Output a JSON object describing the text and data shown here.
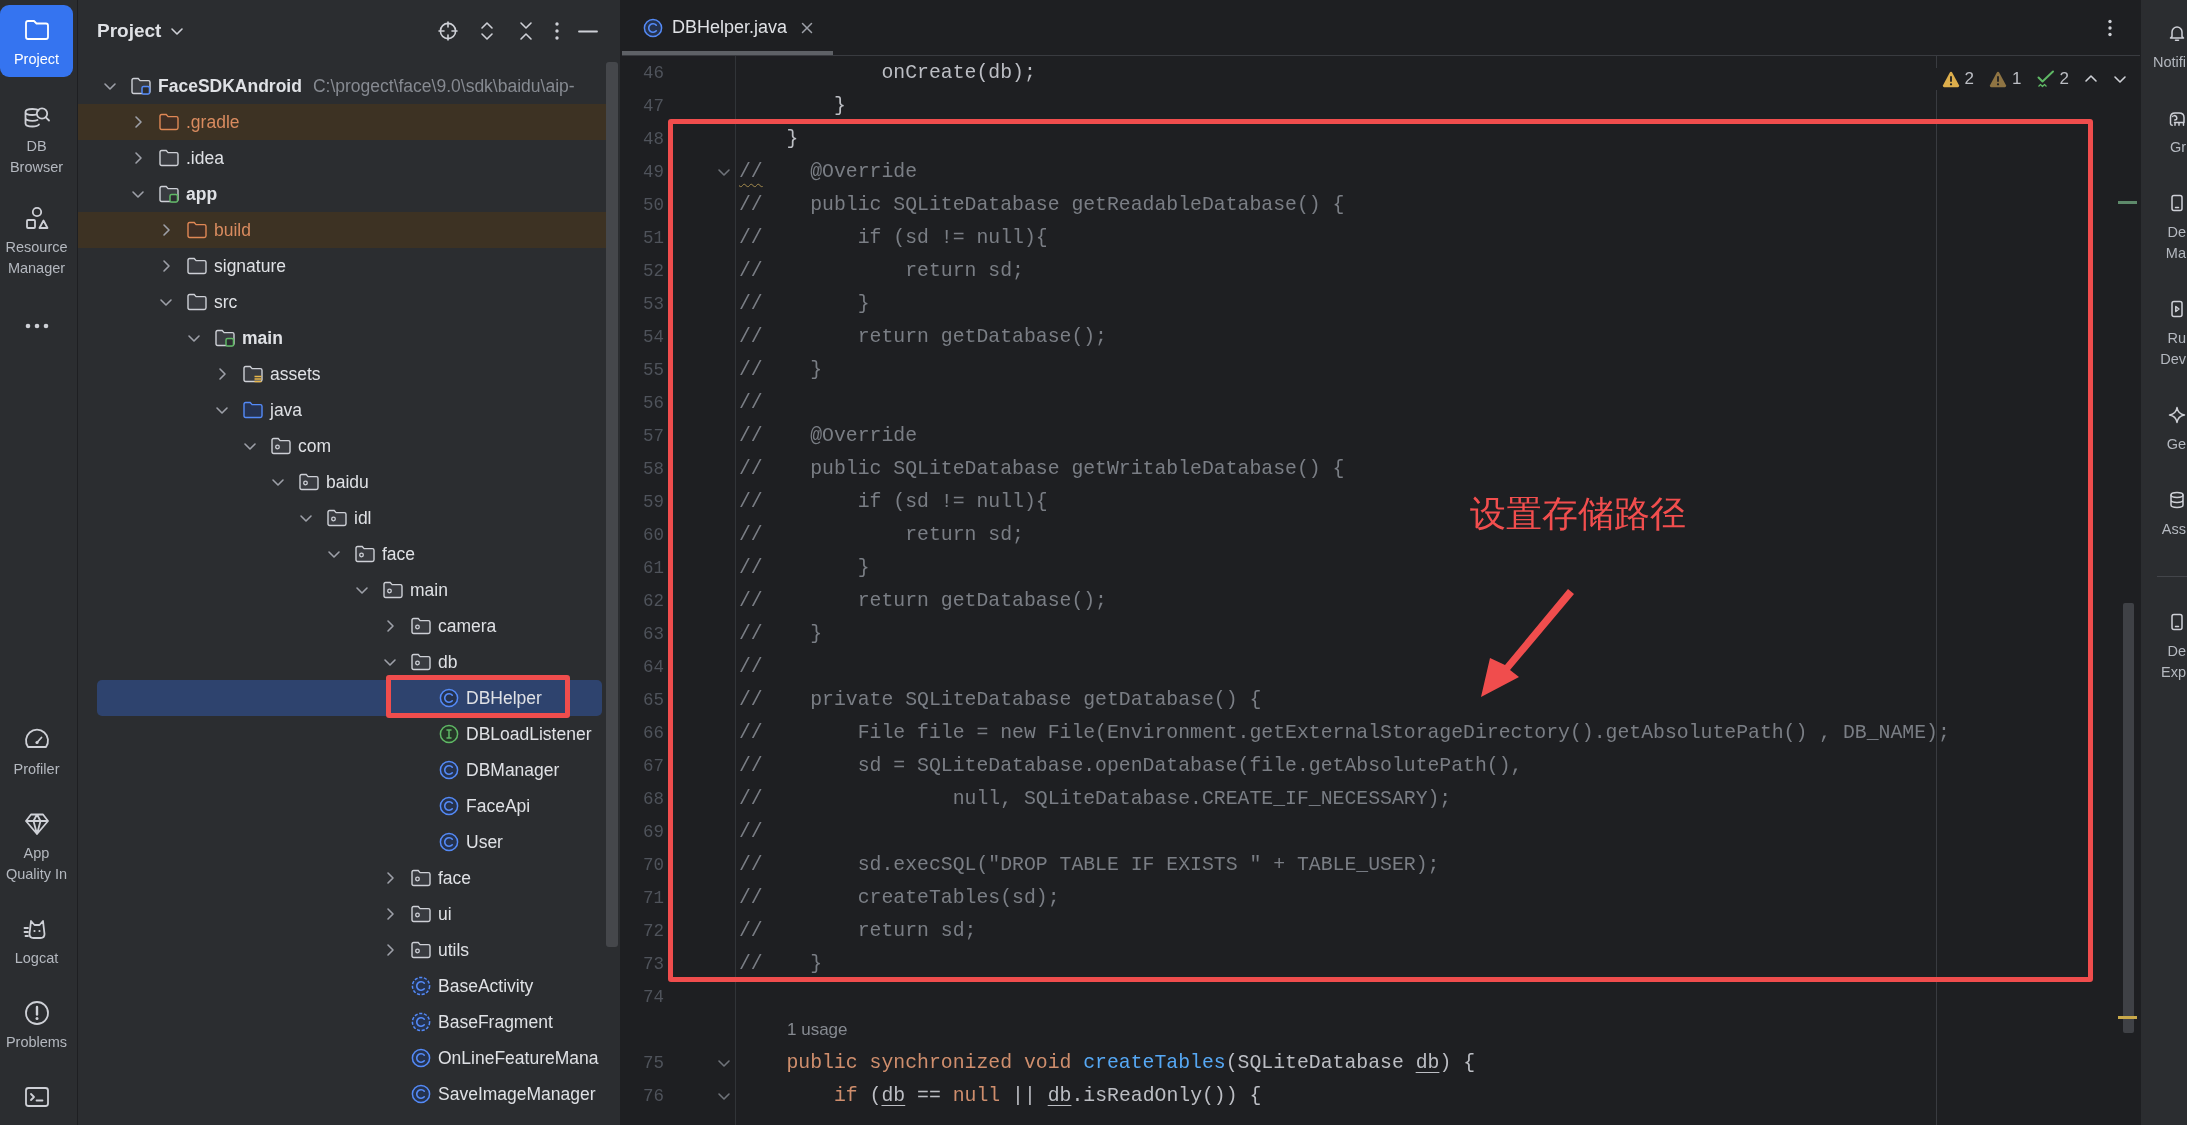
{
  "tool_strip": {
    "top": [
      {
        "kind": "project",
        "label": "Project",
        "selected": true
      },
      {
        "kind": "db_browser",
        "label": "DB Browser",
        "selected": false
      },
      {
        "kind": "resources",
        "label": "Resource Manager",
        "selected": false
      },
      {
        "kind": "more",
        "selected": false
      }
    ],
    "bottom": [
      {
        "kind": "profiler",
        "label": "Profiler",
        "selected": false
      },
      {
        "kind": "quality",
        "label": "App Quality In",
        "selected": false
      },
      {
        "kind": "logcat",
        "label": "Logcat",
        "selected": false
      },
      {
        "kind": "problems",
        "label": "Problems",
        "selected": false
      },
      {
        "kind": "terminal",
        "selected": false
      }
    ]
  },
  "project_panel": {
    "title": "Project",
    "tree": [
      {
        "label": "FaceSDKAndroid",
        "kind": "project",
        "path": "C:\\progect\\face\\9.0\\sdk\\baidu\\aip-",
        "expanded": true,
        "selected": false,
        "annotated": false,
        "children": [
          {
            "label": ".gradle",
            "kind": "excluded",
            "expanded": false,
            "selected": false,
            "annotated": false
          },
          {
            "label": ".idea",
            "kind": "folder",
            "expanded": false,
            "selected": false,
            "annotated": false
          },
          {
            "label": "app",
            "kind": "module",
            "expanded": true,
            "selected": false,
            "annotated": false,
            "children": [
              {
                "label": "build",
                "kind": "excluded",
                "expanded": false,
                "selected": false,
                "annotated": false
              },
              {
                "label": "signature",
                "kind": "folder",
                "expanded": false,
                "selected": false,
                "annotated": false
              },
              {
                "label": "src",
                "kind": "folder",
                "expanded": true,
                "selected": false,
                "annotated": false,
                "children": [
                  {
                    "label": "main",
                    "kind": "module",
                    "expanded": true,
                    "selected": false,
                    "annotated": false,
                    "children": [
                      {
                        "label": "assets",
                        "kind": "resources",
                        "expanded": false,
                        "selected": false,
                        "annotated": false
                      },
                      {
                        "label": "java",
                        "kind": "source_root",
                        "expanded": true,
                        "selected": false,
                        "annotated": false,
                        "children": [
                          {
                            "label": "com",
                            "kind": "package",
                            "expanded": true,
                            "selected": false,
                            "annotated": false,
                            "children": [
                              {
                                "label": "baidu",
                                "kind": "package",
                                "expanded": true,
                                "selected": false,
                                "annotated": false,
                                "children": [
                                  {
                                    "label": "idl",
                                    "kind": "package",
                                    "expanded": true,
                                    "selected": false,
                                    "annotated": false,
                                    "children": [
                                      {
                                        "label": "face",
                                        "kind": "package",
                                        "expanded": true,
                                        "selected": false,
                                        "annotated": false,
                                        "children": [
                                          {
                                            "label": "main",
                                            "kind": "package",
                                            "expanded": true,
                                            "selected": false,
                                            "annotated": false,
                                            "children": [
                                              {
                                                "label": "camera",
                                                "kind": "package",
                                                "expanded": false,
                                                "selected": false,
                                                "annotated": false
                                              },
                                              {
                                                "label": "db",
                                                "kind": "package",
                                                "expanded": true,
                                                "selected": false,
                                                "annotated": false,
                                                "children": [
                                                  {
                                                    "label": "DBHelper",
                                                    "kind": "class",
                                                    "selected": true,
                                                    "annotated": true
                                                  },
                                                  {
                                                    "label": "DBLoadListener",
                                                    "kind": "interface",
                                                    "selected": false,
                                                    "annotated": false
                                                  },
                                                  {
                                                    "label": "DBManager",
                                                    "kind": "class",
                                                    "selected": false,
                                                    "annotated": false
                                                  },
                                                  {
                                                    "label": "FaceApi",
                                                    "kind": "class",
                                                    "selected": false,
                                                    "annotated": false
                                                  },
                                                  {
                                                    "label": "User",
                                                    "kind": "class",
                                                    "selected": false,
                                                    "annotated": false
                                                  }
                                                ]
                                              },
                                              {
                                                "label": "face",
                                                "kind": "package",
                                                "expanded": false,
                                                "selected": false,
                                                "annotated": false
                                              },
                                              {
                                                "label": "ui",
                                                "kind": "package",
                                                "expanded": false,
                                                "selected": false,
                                                "annotated": false
                                              },
                                              {
                                                "label": "utils",
                                                "kind": "package",
                                                "expanded": false,
                                                "selected": false,
                                                "annotated": false
                                              },
                                              {
                                                "label": "BaseActivity",
                                                "kind": "abstract_class",
                                                "selected": false,
                                                "annotated": false
                                              },
                                              {
                                                "label": "BaseFragment",
                                                "kind": "abstract_class",
                                                "selected": false,
                                                "annotated": false
                                              },
                                              {
                                                "label": "OnLineFeatureMana",
                                                "kind": "class",
                                                "selected": false,
                                                "annotated": false
                                              },
                                              {
                                                "label": "SaveImageManager",
                                                "kind": "class",
                                                "selected": false,
                                                "annotated": false
                                              }
                                            ]
                                          }
                                        ]
                                      }
                                    ]
                                  }
                                ]
                              }
                            ]
                          }
                        ]
                      }
                    ]
                  }
                ]
              }
            ]
          }
        ]
      }
    ]
  },
  "editor": {
    "tabs": [
      {
        "label": "DBHelper.java",
        "kind": "class",
        "selected": true
      }
    ],
    "inspections": [
      {
        "kind": "warning",
        "count": "2"
      },
      {
        "kind": "weak_warning",
        "count": "1"
      },
      {
        "kind": "typo",
        "count": "2"
      }
    ],
    "lines_before": [
      {
        "number": "46",
        "foldable": false,
        "tokens": [
          {
            "text": "            onCreate(db);",
            "kind": "plain"
          }
        ]
      },
      {
        "number": "47",
        "foldable": false,
        "tokens": [
          {
            "text": "        }",
            "kind": "plain"
          }
        ]
      }
    ],
    "callout": {
      "label": "设置存储路径",
      "lines": [
        {
          "number": "48",
          "foldable": false,
          "tokens": [
            {
              "text": "    }",
              "kind": "plain"
            }
          ]
        },
        {
          "number": "49",
          "foldable": true,
          "tokens": [
            {
              "text": "//",
              "kind": "flagged_comment"
            },
            {
              "text": "    @Override",
              "kind": "comment"
            }
          ]
        },
        {
          "number": "50",
          "foldable": false,
          "tokens": [
            {
              "text": "//    public SQLiteDatabase getReadableDatabase() {",
              "kind": "comment"
            }
          ]
        },
        {
          "number": "51",
          "foldable": false,
          "tokens": [
            {
              "text": "//        if (sd != null){",
              "kind": "comment"
            }
          ]
        },
        {
          "number": "52",
          "foldable": false,
          "tokens": [
            {
              "text": "//            return sd;",
              "kind": "comment"
            }
          ]
        },
        {
          "number": "53",
          "foldable": false,
          "tokens": [
            {
              "text": "//        }",
              "kind": "comment"
            }
          ]
        },
        {
          "number": "54",
          "foldable": false,
          "tokens": [
            {
              "text": "//        return getDatabase();",
              "kind": "comment"
            }
          ]
        },
        {
          "number": "55",
          "foldable": false,
          "tokens": [
            {
              "text": "//    }",
              "kind": "comment"
            }
          ]
        },
        {
          "number": "56",
          "foldable": false,
          "tokens": [
            {
              "text": "//",
              "kind": "comment"
            }
          ]
        },
        {
          "number": "57",
          "foldable": false,
          "tokens": [
            {
              "text": "//    @Override",
              "kind": "comment"
            }
          ]
        },
        {
          "number": "58",
          "foldable": false,
          "tokens": [
            {
              "text": "//    public SQLiteDatabase getWritableDatabase() {",
              "kind": "comment"
            }
          ]
        },
        {
          "number": "59",
          "foldable": false,
          "tokens": [
            {
              "text": "//        if (sd != null){",
              "kind": "comment"
            }
          ]
        },
        {
          "number": "60",
          "foldable": false,
          "tokens": [
            {
              "text": "//            return sd;",
              "kind": "comment"
            }
          ]
        },
        {
          "number": "61",
          "foldable": false,
          "tokens": [
            {
              "text": "//        }",
              "kind": "comment"
            }
          ]
        },
        {
          "number": "62",
          "foldable": false,
          "tokens": [
            {
              "text": "//        return getDatabase();",
              "kind": "comment"
            }
          ]
        },
        {
          "number": "63",
          "foldable": false,
          "tokens": [
            {
              "text": "//    }",
              "kind": "comment"
            }
          ]
        },
        {
          "number": "64",
          "foldable": false,
          "tokens": [
            {
              "text": "//",
              "kind": "comment"
            }
          ]
        },
        {
          "number": "65",
          "foldable": false,
          "tokens": [
            {
              "text": "//    private SQLiteDatabase getDatabase() {",
              "kind": "comment"
            }
          ]
        },
        {
          "number": "66",
          "foldable": false,
          "tokens": [
            {
              "text": "//        File file = new File(Environment.getExternalStorageDirectory().getAbsolutePath() , DB_NAME);",
              "kind": "comment"
            }
          ]
        },
        {
          "number": "67",
          "foldable": false,
          "tokens": [
            {
              "text": "//        sd = SQLiteDatabase.openDatabase(file.getAbsolutePath(),",
              "kind": "comment"
            }
          ]
        },
        {
          "number": "68",
          "foldable": false,
          "tokens": [
            {
              "text": "//                null, SQLiteDatabase.CREATE_IF_NECESSARY);",
              "kind": "comment"
            }
          ]
        },
        {
          "number": "69",
          "foldable": false,
          "tokens": [
            {
              "text": "//",
              "kind": "comment"
            }
          ]
        },
        {
          "number": "70",
          "foldable": false,
          "tokens": [
            {
              "text": "//        sd.execSQL(\"DROP TABLE IF EXISTS \" + TABLE_USER);",
              "kind": "comment"
            }
          ]
        },
        {
          "number": "71",
          "foldable": false,
          "tokens": [
            {
              "text": "//        createTables(sd);",
              "kind": "comment"
            }
          ]
        },
        {
          "number": "72",
          "foldable": false,
          "tokens": [
            {
              "text": "//        return sd;",
              "kind": "comment"
            }
          ]
        },
        {
          "number": "73",
          "foldable": false,
          "tokens": [
            {
              "text": "//    }",
              "kind": "comment"
            }
          ]
        }
      ]
    },
    "lines_after": [
      {
        "number": "74",
        "foldable": false
      },
      {
        "number": "75",
        "foldable": true,
        "hint": "1 usage",
        "tokens": [
          {
            "text": "    public synchronized void ",
            "kind": "keyword"
          },
          {
            "text": "createTables",
            "kind": "method"
          },
          {
            "text": "(SQLiteDatabase ",
            "kind": "plain"
          },
          {
            "text": "db",
            "kind": "param"
          },
          {
            "text": ") {",
            "kind": "plain"
          }
        ]
      },
      {
        "number": "76",
        "foldable": true,
        "tokens": [
          {
            "text": "        if",
            "kind": "keyword"
          },
          {
            "text": " (",
            "kind": "plain"
          },
          {
            "text": "db",
            "kind": "param"
          },
          {
            "text": " == ",
            "kind": "plain"
          },
          {
            "text": "null",
            "kind": "keyword"
          },
          {
            "text": " || ",
            "kind": "plain"
          },
          {
            "text": "db",
            "kind": "param"
          },
          {
            "text": ".isReadOnly()) {",
            "kind": "plain"
          }
        ]
      }
    ]
  },
  "right_strip": {
    "top": [
      {
        "kind": "bell",
        "label": "Notifi",
        "selected": false
      },
      {
        "kind": "elephant",
        "label": "Gr",
        "selected": false
      },
      {
        "kind": "phone",
        "label": "De Ma",
        "selected": false
      },
      {
        "kind": "device",
        "label": "Ru Dev",
        "selected": false
      },
      {
        "kind": "spark",
        "label": "Ge",
        "selected": false
      },
      {
        "kind": "database",
        "label": "Ass",
        "selected": false
      }
    ],
    "bottom": [
      {
        "kind": "phone",
        "label": "De Exp",
        "selected": false
      }
    ]
  }
}
